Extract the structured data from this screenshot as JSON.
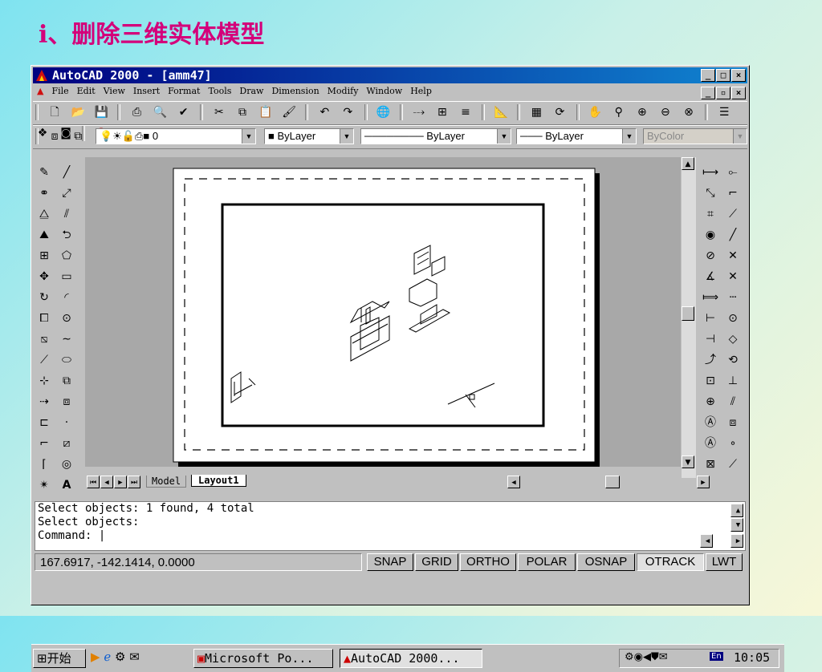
{
  "slide": {
    "title": "i、删除三维实体模型"
  },
  "window": {
    "title": "AutoCAD 2000 - [amm47]",
    "controls": [
      "_",
      "□",
      "×"
    ],
    "doc_controls": [
      "_",
      "▫",
      "×"
    ]
  },
  "menu": [
    "File",
    "Edit",
    "View",
    "Insert",
    "Format",
    "Tools",
    "Draw",
    "Dimension",
    "Modify",
    "Window",
    "Help"
  ],
  "toolbar_icons": [
    "new-icon",
    "open-icon",
    "save-icon",
    "print-icon",
    "preview-icon",
    "spell-icon",
    "cut-icon",
    "copy-icon",
    "paste-icon",
    "matchprop-icon",
    "undo-icon",
    "redo-icon",
    "hyperlink-icon",
    "tracking-icon",
    "ucs-icon",
    "inquiry-icon",
    "distance-icon",
    "aerial-icon",
    "redraw-icon",
    "pan-icon",
    "zoom-rt-icon",
    "zoom-win-icon",
    "zoom-prev-icon",
    "properties-icon",
    "designcenter-icon",
    "help-icon"
  ],
  "properties_bar": {
    "layer": "0",
    "color": "ByLayer",
    "linetype": "ByLayer",
    "lineweight": "ByLayer",
    "plotstyle": "ByColor"
  },
  "tabs": {
    "model": "Model",
    "layout": "Layout1"
  },
  "command_lines": [
    "Select objects: 1 found, 4 total",
    "Select objects:",
    "Command: |"
  ],
  "status": {
    "coords": "167.6917, -142.1414, 0.0000",
    "buttons": [
      "SNAP",
      "GRID",
      "ORTHO",
      "POLAR",
      "OSNAP",
      "OTRACK",
      "LWT"
    ]
  },
  "taskbar": {
    "start": "开始",
    "tasks": [
      "Microsoft Po...",
      "AutoCAD 2000..."
    ],
    "clock": "10:05",
    "ime": "En"
  }
}
